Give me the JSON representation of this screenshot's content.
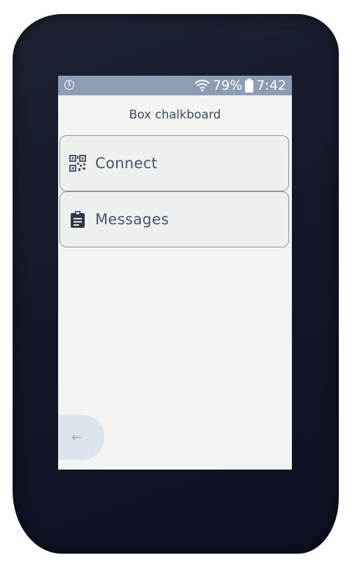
{
  "status_bar": {
    "battery_percent": "79%",
    "time": "7:42",
    "alert_icon": "alert-circle-icon",
    "wifi_icon": "wifi-icon",
    "battery_icon": "battery-icon",
    "background_color": "#8d9db3"
  },
  "page": {
    "title": "Box chalkboard"
  },
  "menu": {
    "items": [
      {
        "label": "Connect",
        "icon": "qr-code-icon"
      },
      {
        "label": "Messages",
        "icon": "clipboard-icon"
      }
    ]
  },
  "navigation": {
    "back_icon": "back-arrow-icon",
    "back_glyph": "←"
  }
}
